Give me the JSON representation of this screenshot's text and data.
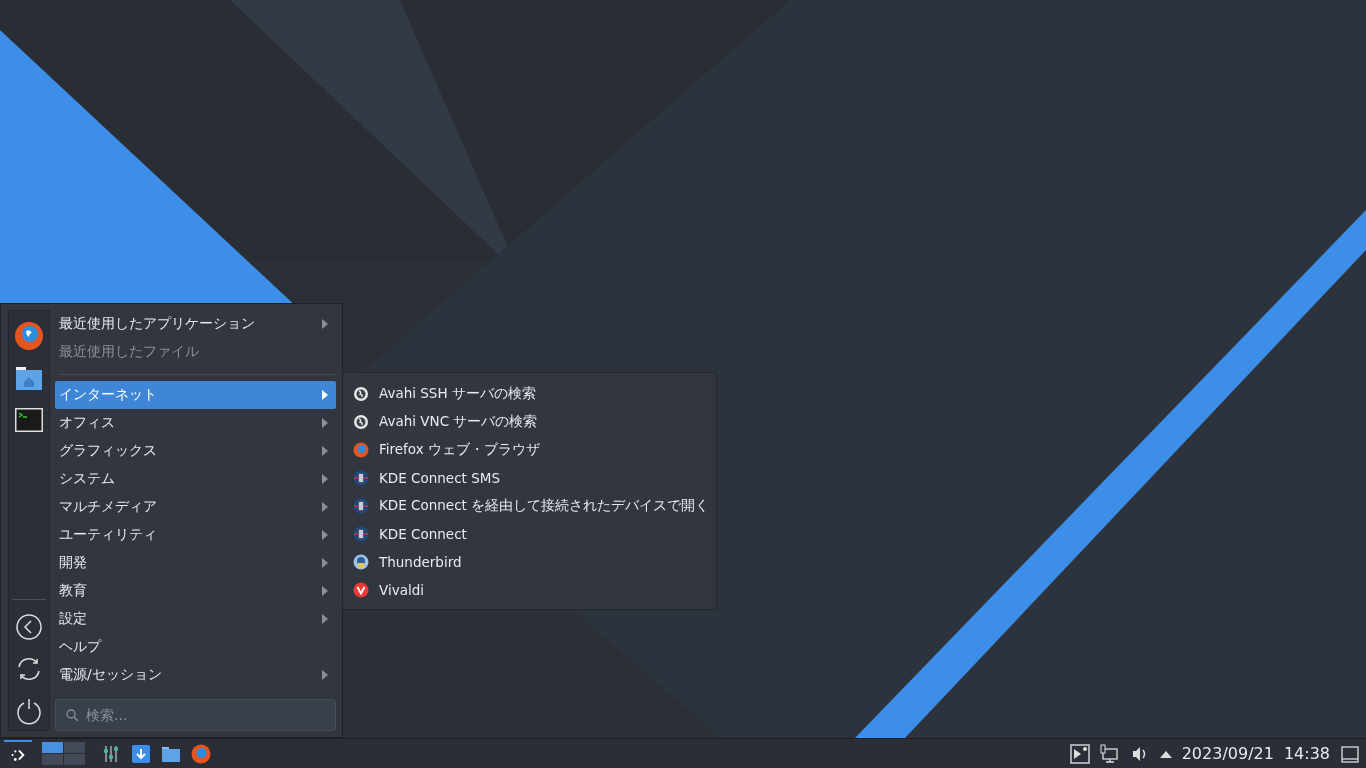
{
  "menu": {
    "sections": [
      [
        {
          "label": "最近使用したアプリケーション",
          "has_submenu": true,
          "selected": false,
          "disabled": false
        },
        {
          "label": "最近使用したファイル",
          "has_submenu": false,
          "selected": false,
          "disabled": true
        }
      ],
      [
        {
          "label": "インターネット",
          "has_submenu": true,
          "selected": true,
          "disabled": false
        },
        {
          "label": "オフィス",
          "has_submenu": true,
          "selected": false,
          "disabled": false
        },
        {
          "label": "グラフィックス",
          "has_submenu": true,
          "selected": false,
          "disabled": false
        },
        {
          "label": "システム",
          "has_submenu": true,
          "selected": false,
          "disabled": false
        },
        {
          "label": "マルチメディア",
          "has_submenu": true,
          "selected": false,
          "disabled": false
        },
        {
          "label": "ユーティリティ",
          "has_submenu": true,
          "selected": false,
          "disabled": false
        },
        {
          "label": "開発",
          "has_submenu": true,
          "selected": false,
          "disabled": false
        },
        {
          "label": "教育",
          "has_submenu": true,
          "selected": false,
          "disabled": false
        },
        {
          "label": "設定",
          "has_submenu": true,
          "selected": false,
          "disabled": false
        },
        {
          "label": "ヘルプ",
          "has_submenu": false,
          "selected": false,
          "disabled": false
        },
        {
          "label": "電源/セッション",
          "has_submenu": true,
          "selected": false,
          "disabled": false
        }
      ]
    ],
    "search": {
      "placeholder": "検索..."
    }
  },
  "submenu": {
    "items": [
      {
        "label": "Avahi SSH サーバの検索",
        "kind": "globe"
      },
      {
        "label": "Avahi VNC サーバの検索",
        "kind": "globe"
      },
      {
        "label": "Firefox ウェブ・ブラウザ",
        "kind": "firefox"
      },
      {
        "label": "KDE Connect SMS",
        "kind": "phone"
      },
      {
        "label": "KDE Connect を経由して接続されたデバイスで開く",
        "kind": "phone"
      },
      {
        "label": "KDE Connect",
        "kind": "phone"
      },
      {
        "label": "Thunderbird",
        "kind": "thunderbird"
      },
      {
        "label": "Vivaldi",
        "kind": "vivaldi"
      }
    ]
  },
  "taskbar": {
    "pager": [
      {
        "selected": true
      },
      {
        "selected": false
      },
      {
        "selected": false
      },
      {
        "selected": false
      }
    ],
    "date": "2023/09/21",
    "time": "14:38"
  }
}
